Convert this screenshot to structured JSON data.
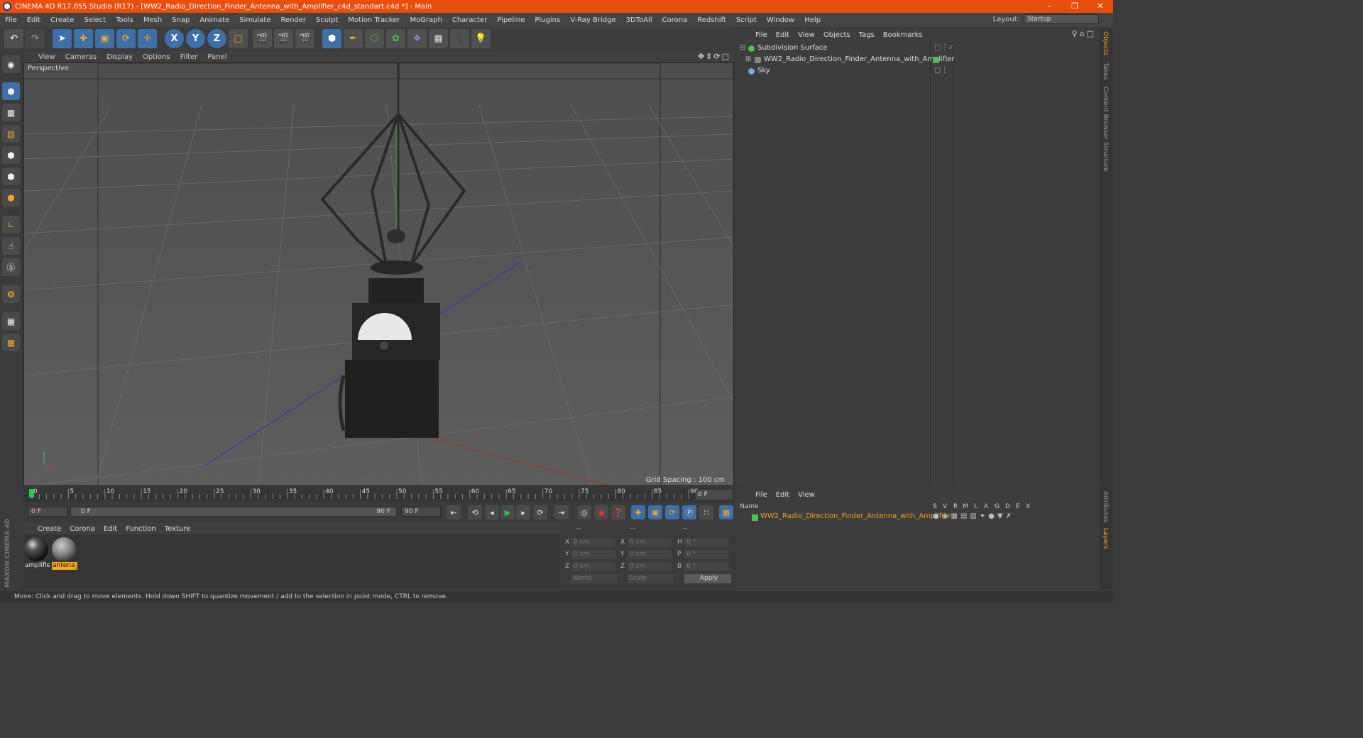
{
  "window": {
    "title": "CINEMA 4D R17.055 Studio (R17) - [WW2_Radio_Direction_Finder_Antenna_with_Amplifier_c4d_standart.c4d *] - Main",
    "controls": [
      "–",
      "❐",
      "✕"
    ]
  },
  "menubar": {
    "items": [
      "File",
      "Edit",
      "Create",
      "Select",
      "Tools",
      "Mesh",
      "Snap",
      "Animate",
      "Simulate",
      "Render",
      "Sculpt",
      "Motion Tracker",
      "MoGraph",
      "Character",
      "Pipeline",
      "Plugins",
      "V-Ray Bridge",
      "3DToAll",
      "Corona",
      "Redshift",
      "Script",
      "Window",
      "Help"
    ],
    "layout_label": "Layout:",
    "layout_value": "Startup"
  },
  "toolbar": {
    "axis_x": "X",
    "axis_y": "Y",
    "axis_z": "Z"
  },
  "viewport": {
    "menu": [
      "View",
      "Cameras",
      "Display",
      "Options",
      "Filter",
      "Panel"
    ],
    "label": "Perspective",
    "grid_spacing": "Grid Spacing : 100 cm"
  },
  "timeline": {
    "ticks": [
      "0",
      "5",
      "10",
      "15",
      "20",
      "25",
      "30",
      "35",
      "40",
      "45",
      "50",
      "55",
      "60",
      "65",
      "70",
      "75",
      "80",
      "85",
      "90"
    ],
    "current_frame": "0 F",
    "start_frame": "0 F",
    "range_start": "0 F",
    "range_end": "90 F",
    "end_frame": "90 F"
  },
  "materials": {
    "menu": [
      "Create",
      "Corona",
      "Edit",
      "Function",
      "Texture"
    ],
    "items": [
      {
        "label": "amplifie"
      },
      {
        "label": "antena_"
      }
    ]
  },
  "coordinates": {
    "header": [
      "--",
      "--",
      "--"
    ],
    "rows": [
      {
        "a": "X",
        "av": "0 cm",
        "b": "X",
        "bv": "0 cm",
        "c": "H",
        "cv": "0 °"
      },
      {
        "a": "Y",
        "av": "0 cm",
        "b": "Y",
        "bv": "0 cm",
        "c": "P",
        "cv": "0 °"
      },
      {
        "a": "Z",
        "av": "0 cm",
        "b": "Z",
        "bv": "0 cm",
        "c": "B",
        "cv": "0 °"
      }
    ],
    "space": "World",
    "mode": "Scale",
    "apply": "Apply"
  },
  "object_manager": {
    "menu": [
      "File",
      "Edit",
      "View",
      "Objects",
      "Tags",
      "Bookmarks"
    ],
    "objects": [
      {
        "name": "Subdivision Surface"
      },
      {
        "name": "WW2_Radio_Direction_Finder_Antenna_with_Amplifier"
      },
      {
        "name": "Sky"
      }
    ]
  },
  "layer_manager": {
    "menu": [
      "File",
      "Edit",
      "View"
    ],
    "columns": [
      "Name",
      "S",
      "V",
      "R",
      "M",
      "L",
      "A",
      "G",
      "D",
      "E",
      "X"
    ],
    "layers": [
      {
        "name": "WW2_Radio_Direction_Finder_Antenna_with_Amplifier"
      }
    ]
  },
  "side_tabs": [
    "Objects",
    "Takes",
    "Content Browser",
    "Structure"
  ],
  "side_tabs_bottom": [
    "Attributes",
    "Layers"
  ],
  "maxon_logo": "MAXON CINEMA 4D",
  "status": "Move: Click and drag to move elements. Hold down SHIFT to quantize movement / add to the selection in point mode, CTRL to remove.",
  "colors": {
    "titlebar": "#e84f0e",
    "accent_blue": "#3d6fa8",
    "layer_name": "#f0a020",
    "object_green": "#4fc04f",
    "timeline_marker": "#22cc44"
  }
}
